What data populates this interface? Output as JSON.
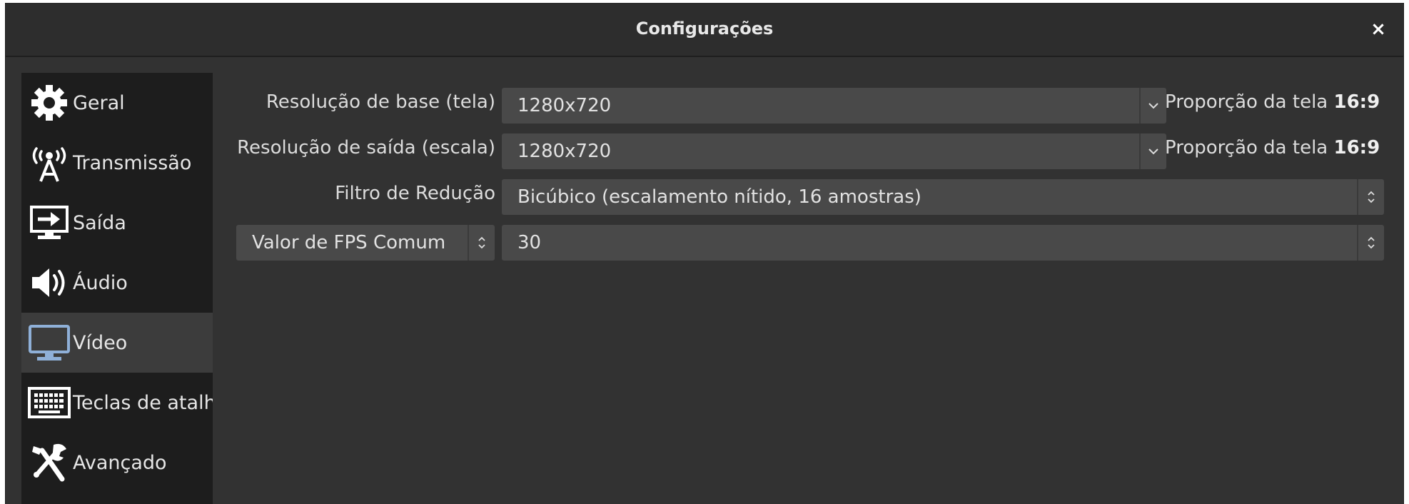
{
  "window": {
    "title": "Configurações",
    "close_label": "×"
  },
  "sidebar": {
    "items": [
      {
        "label": "Geral",
        "icon": "gear-icon"
      },
      {
        "label": "Transmissão",
        "icon": "antenna-icon"
      },
      {
        "label": "Saída",
        "icon": "output-monitor-icon"
      },
      {
        "label": "Áudio",
        "icon": "speaker-icon"
      },
      {
        "label": "Vídeo",
        "icon": "monitor-icon",
        "active": true
      },
      {
        "label": "Teclas de atalh",
        "icon": "keyboard-icon"
      },
      {
        "label": "Avançado",
        "icon": "tools-icon"
      }
    ]
  },
  "video": {
    "base_resolution": {
      "label": "Resolução de base (tela)",
      "value": "1280x720",
      "aspect_label": "Proporção da tela",
      "aspect_value": "16:9"
    },
    "output_resolution": {
      "label": "Resolução de saída (escala)",
      "value": "1280x720",
      "aspect_label": "Proporção da tela",
      "aspect_value": "16:9"
    },
    "downscale_filter": {
      "label": "Filtro de Redução",
      "value": "Bicúbico (escalamento nítido, 16 amostras)"
    },
    "fps": {
      "type_label": "Valor de FPS Comum",
      "value": "30"
    }
  },
  "colors": {
    "window_bg": "#323232",
    "titlebar_bg": "#2d2d2d",
    "sidebar_bg": "#1d1d1d",
    "sidebar_active": "#3c3c3c",
    "field_bg": "#494949",
    "accent_icon": "#8fb0d8"
  }
}
